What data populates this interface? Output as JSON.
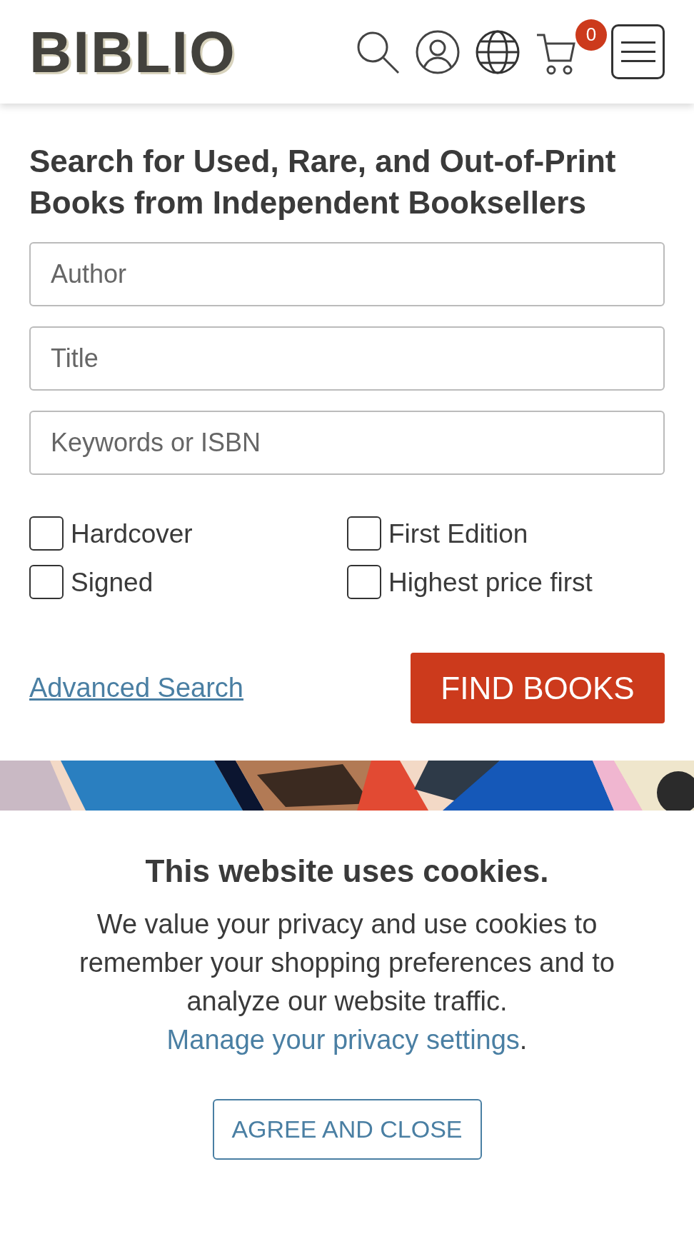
{
  "header": {
    "logo": "BIBLIO",
    "cart_count": "0"
  },
  "search": {
    "heading": "Search for Used, Rare, and Out-of-Print Books from Independent Booksellers",
    "fields": [
      {
        "placeholder": "Author"
      },
      {
        "placeholder": "Title"
      },
      {
        "placeholder": "Keywords or ISBN"
      }
    ],
    "options": [
      {
        "label": "Hardcover",
        "checked": false
      },
      {
        "label": "First Edition",
        "checked": false
      },
      {
        "label": "Signed",
        "checked": false
      },
      {
        "label": "Highest price first",
        "checked": false
      }
    ],
    "advanced_link": "Advanced Search",
    "submit": "FIND BOOKS"
  },
  "cookie": {
    "title": "This website uses cookies.",
    "text": "We value your privacy and use cookies to remember your shopping preferences and to analyze our website traffic. ",
    "link": "Manage your privacy settings",
    "after": ".",
    "button": "AGREE AND CLOSE"
  }
}
